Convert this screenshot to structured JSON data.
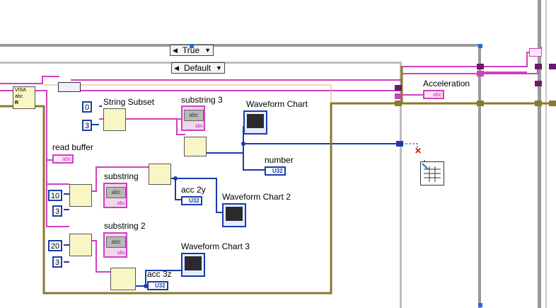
{
  "case_outer": {
    "value": "True",
    "left_arrow": "◀",
    "right_arrow": "▼"
  },
  "case_inner": {
    "value": "Default",
    "left_arrow": "◀",
    "right_arrow": "▼"
  },
  "visa": {
    "line1": "VISA",
    "line2": "abc",
    "line3": "R"
  },
  "labels": {
    "string_subset": "String Subset",
    "substring3": "substring 3",
    "waveform_chart": "Waveform Chart",
    "read_buffer": "read buffer",
    "number": "number",
    "substring": "substring",
    "acc2y": "acc 2y",
    "waveform_chart2": "Waveform Chart 2",
    "substring2": "substring 2",
    "waveform_chart3": "Waveform Chart 3",
    "acc3z": "acc 3z",
    "acceleration": "Acceleration"
  },
  "constants": {
    "c0": "0",
    "c3a": "3",
    "c10": "10",
    "c3b": "3",
    "c20": "20",
    "c3c": "3"
  },
  "indicators": {
    "abc": "abc",
    "u32": "U32"
  },
  "colors": {
    "string": "#d040c0",
    "numeric": "#1a3ca8",
    "bool": "#1e7a1e",
    "cluster": "#7a6a1a",
    "struct": "#9a9a9a"
  }
}
